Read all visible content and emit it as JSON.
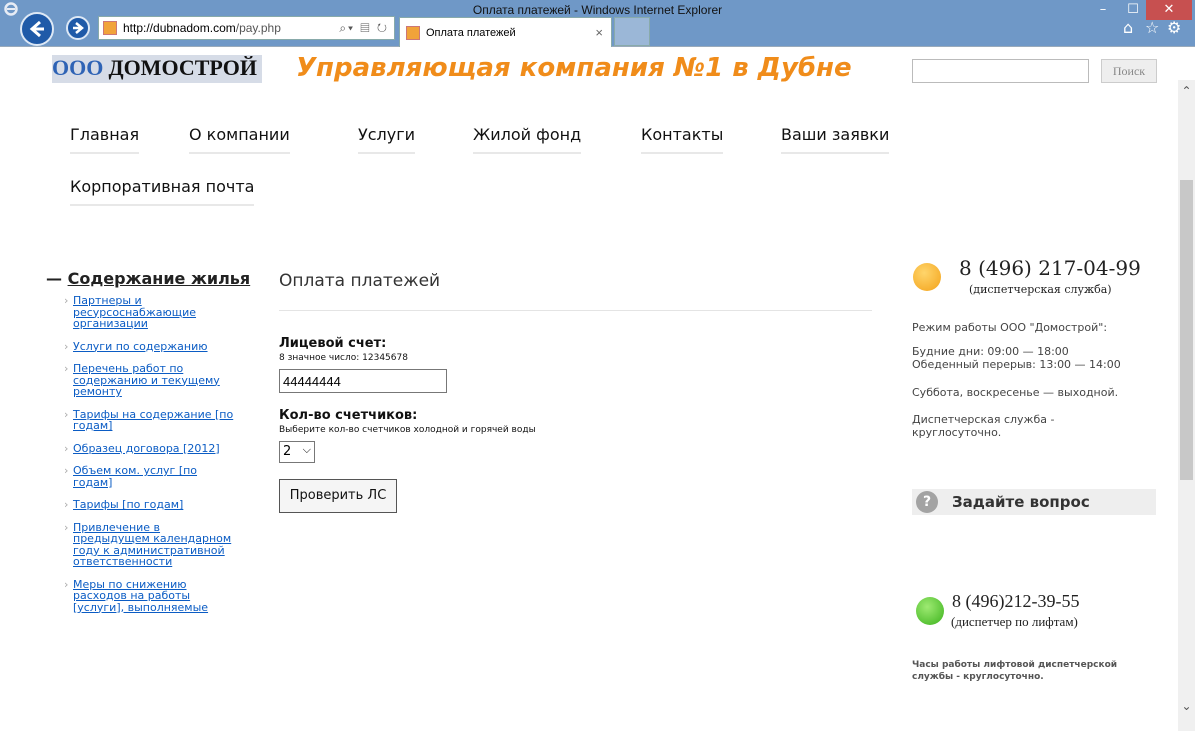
{
  "browser": {
    "window_title": "Оплата платежей - Windows Internet Explorer",
    "url_host": "http://dubnadom.com",
    "url_path": "/pay.php",
    "tab_title": "Оплата платежей"
  },
  "header": {
    "logo_ooo": "ООО",
    "logo_name": "ДОМОСТРОЙ",
    "slogan": "Управляющая компания №1 в Дубне",
    "search_placeholder": "",
    "search_button": "Поиск"
  },
  "menu": [
    "Главная",
    "О компании",
    "Услуги",
    "Жилой фонд",
    "Контакты",
    "Ваши заявки",
    "Корпоративная почта"
  ],
  "sidebar": {
    "title": "Содержание жилья",
    "items": [
      "Партнеры и ресурсоснабжающие организации",
      "Услуги по содержанию",
      "Перечень работ по содержанию и текущему ремонту",
      "Тарифы на содержание [по годам]",
      "Образец договора [2012]",
      "Объем ком. услуг [по годам]",
      "Тарифы [по годам]",
      "Привлечение в предыдущем календарном году к административной ответственности",
      "Меры по снижению расходов на работы [услуги], выполняемые"
    ]
  },
  "main": {
    "title": "Оплата платежей",
    "account_label": "Лицевой счет:",
    "account_hint": "8 значное число: 12345678",
    "account_value": "44444444",
    "counters_label": "Кол-во счетчиков:",
    "counters_hint": "Выберите кол-во счетчиков холодной и горячей воды",
    "counters_value": "2",
    "check_button": "Проверить ЛС"
  },
  "right": {
    "phone1": "8 (496) 217-04-99",
    "phone1_sub": "(диспетчерская служба)",
    "hours_title": "Режим работы ООО \"Домострой\":",
    "weekdays": "Будние дни: 09:00 — 18:00",
    "lunch": "Обеденный перерыв: 13:00 — 14:00",
    "weekend": "Суббота, воскресенье — выходной.",
    "dispatch": "Диспетчерская служба - круглосуточно.",
    "ask": "Задайте вопрос",
    "phone2": "8 (496)212-39-55",
    "phone2_sub": "(диспетчер по лифтам)",
    "lift_hours": "Часы работы лифтовой диспетчерской службы - круглосуточно."
  }
}
